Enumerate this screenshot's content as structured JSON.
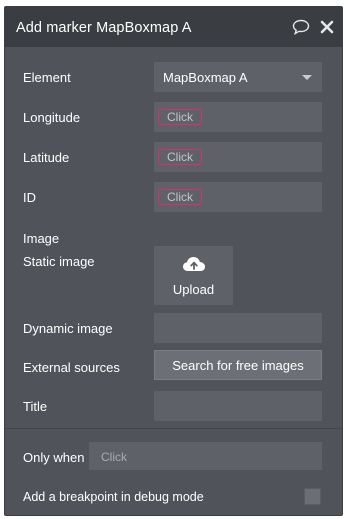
{
  "header": {
    "title": "Add marker MapBoxmap A",
    "icons": [
      "comment-icon",
      "close-icon"
    ]
  },
  "fields": {
    "element": {
      "label": "Element",
      "value": "MapBoxmap A"
    },
    "longitude": {
      "label": "Longitude",
      "chip": "Click"
    },
    "latitude": {
      "label": "Latitude",
      "chip": "Click"
    },
    "id": {
      "label": "ID",
      "chip": "Click"
    },
    "image_heading": "Image",
    "static_image": {
      "label": "Static image",
      "button": "Upload"
    },
    "dynamic_image": {
      "label": "Dynamic image",
      "value": ""
    },
    "external_sources": {
      "label": "External sources",
      "button": "Search for free images"
    },
    "title": {
      "label": "Title",
      "value": ""
    }
  },
  "footer": {
    "only_when": {
      "label": "Only when",
      "placeholder": "Click"
    },
    "breakpoint": {
      "label": "Add a breakpoint in debug mode",
      "checked": false
    }
  },
  "colors": {
    "panel": "#50545a",
    "header": "#3a3d41",
    "field": "#5e6268",
    "chip_border": "#d8316a"
  }
}
